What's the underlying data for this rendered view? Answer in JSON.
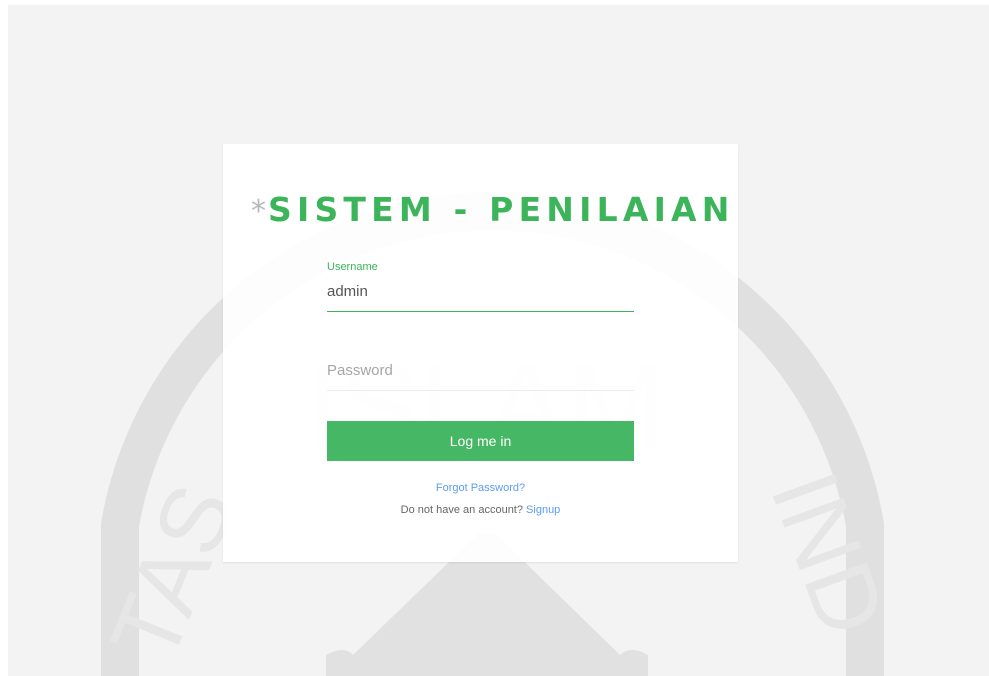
{
  "brand": {
    "star": "*",
    "title": "SISTEM - PENILAIAN"
  },
  "watermark": {
    "text_top": "ISLAM",
    "text_left": "TAS",
    "text_right": "IND"
  },
  "form": {
    "username": {
      "label": "Username",
      "value": "admin"
    },
    "password": {
      "placeholder": "Password",
      "value": ""
    },
    "submit_label": "Log me in",
    "forgot_label": "Forgot Password?",
    "signup_prompt": "Do not have an account?",
    "signup_label": "Signup"
  },
  "colors": {
    "accent": "#3cb45a",
    "button": "#46b764",
    "link": "#5b9cf2",
    "background": "#f3f3f3"
  }
}
